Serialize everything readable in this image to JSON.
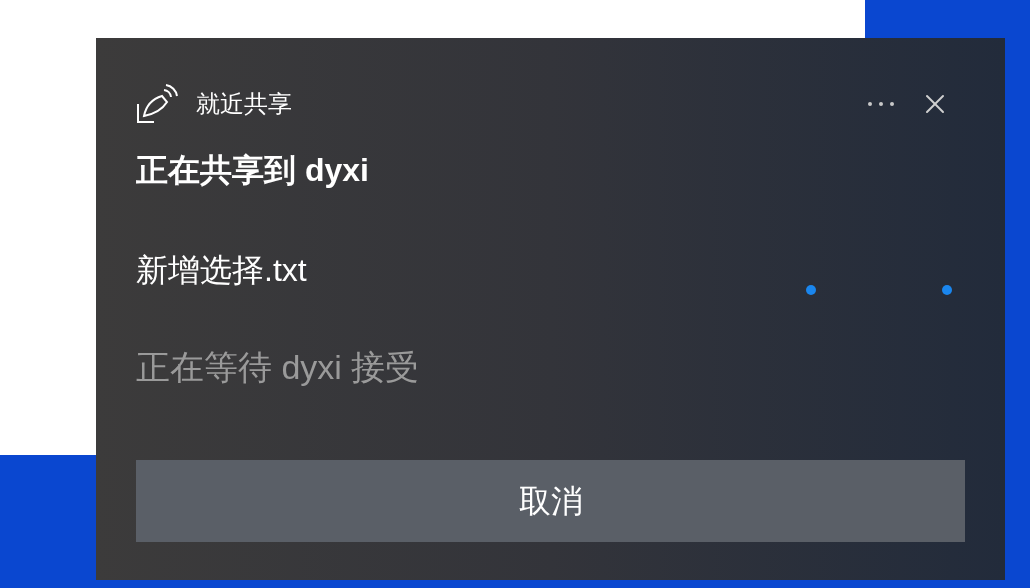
{
  "dialog": {
    "title": "就近共享",
    "heading": "正在共享到 dyxi",
    "file_name": "新增选择.txt",
    "status": "正在等待 dyxi 接受",
    "buttons": [
      "取消"
    ]
  }
}
